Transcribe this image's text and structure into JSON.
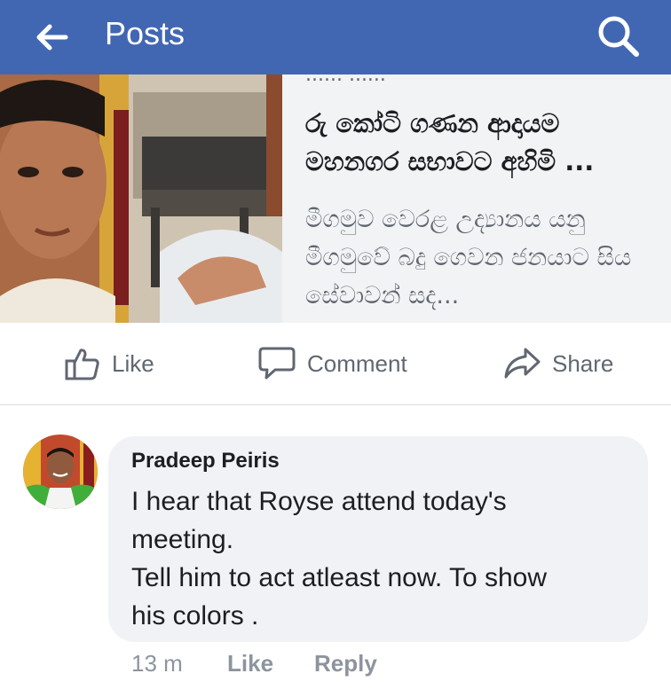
{
  "header": {
    "title": "Posts",
    "back_icon": "arrow-left-icon",
    "search_icon": "search-icon",
    "bg_color": "#4267b2"
  },
  "link_card": {
    "title": "රු කෝටි ගණන ආදායම මහනගර සභාවට අහිමි ...",
    "description": "මීගමුව වෙරළ උද්‍යානය යනු මීගමුවේ බදු ගෙවන ජනයාට සිය සේවාවන් සද...",
    "truncated_top": "...... ......"
  },
  "actions": {
    "like": "Like",
    "comment": "Comment",
    "share": "Share"
  },
  "comment": {
    "author": "Pradeep Peiris",
    "text_line1": "I hear that Royse attend today's",
    "text_line2": "meeting.",
    "text_line3": "Tell him to act atleast now. To show",
    "text_line4": "his colors .",
    "time": "13 m",
    "like": "Like",
    "reply": "Reply"
  }
}
